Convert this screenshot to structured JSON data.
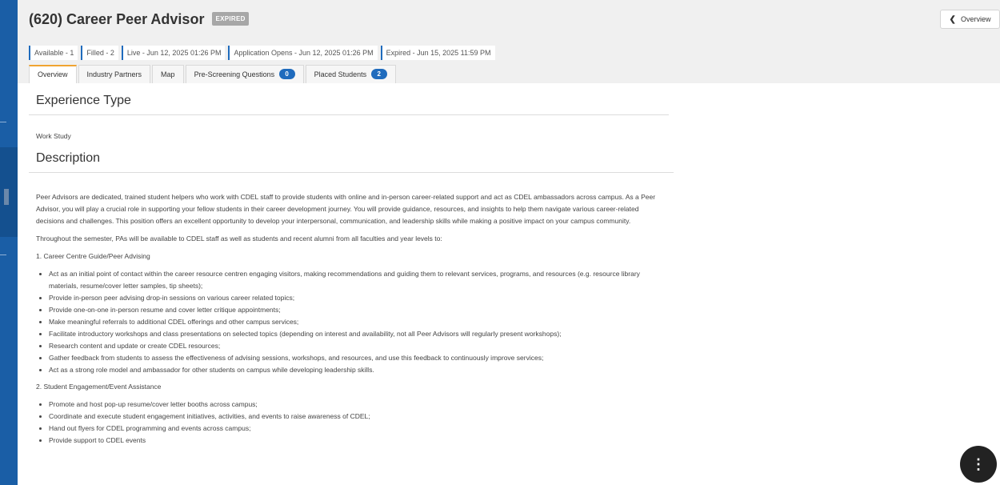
{
  "header": {
    "title": "(620) Career Peer Advisor",
    "status_badge": "EXPIRED",
    "back_button": "Overview",
    "stats": [
      "Available - 1",
      "Filled - 2",
      "Live - Jun 12, 2025 01:26 PM",
      "Application Opens - Jun 12, 2025 01:26 PM",
      "Expired - Jun 15, 2025 11:59 PM"
    ],
    "tabs": [
      {
        "label": "Overview",
        "active": true
      },
      {
        "label": "Industry Partners"
      },
      {
        "label": "Map"
      },
      {
        "label": "Pre-Screening Questions",
        "badge": "0"
      },
      {
        "label": "Placed Students",
        "badge": "2"
      }
    ]
  },
  "experience": {
    "heading": "Experience Type",
    "value": "Work Study"
  },
  "description": {
    "heading": "Description",
    "intro": "Peer Advisors are dedicated, trained student helpers who work with CDEL staff to provide students with online and in-person career-related support and act as CDEL ambassadors across campus. As a Peer Advisor, you will play a crucial role in supporting your fellow students in their career development journey. You will provide guidance, resources, and insights to help them navigate various career-related decisions and challenges. This position offers an excellent opportunity to develop your interpersonal, communication, and leadership skills while making a positive impact on your campus community.",
    "semester": "Throughout the semester, PAs will be available to CDEL staff as well as students and recent alumni from all faculties and year levels to:",
    "section1_title": "1. Career Centre Guide/Peer Advising",
    "section1_items": [
      "Act as an initial point of contact within the career resource centren engaging visitors, making recommendations and guiding them to relevant services, programs, and resources (e.g. resource library materials, resume/cover letter samples, tip sheets);",
      "Provide in-person peer advising drop-in sessions on various career related topics;",
      "Provide one-on-one in-person resume and cover letter critique appointments;",
      "Make meaningful referrals to additional CDEL offerings and other campus services;",
      "Facilitate introductory workshops and class presentations on selected topics (depending on interest and availability, not all Peer Advisors will regularly present workshops);",
      "Research content and update or create CDEL resources;",
      "Gather feedback from students to assess the effectiveness of advising sessions, workshops, and resources, and use this feedback to continuously improve services;",
      "Act as a strong role model and ambassador for other students on campus while developing leadership skills."
    ],
    "section2_title": "2. Student Engagement/Event Assistance",
    "section2_items": [
      "Promote and host pop-up resume/cover letter booths across campus;",
      "Coordinate and execute student engagement initiatives, activities, and events to raise awareness of CDEL;",
      "Hand out flyers for CDEL programming and events across campus;",
      "Provide support to CDEL events"
    ]
  },
  "fab": {
    "glyph": "⋮"
  },
  "colors": {
    "accent_blue": "#1f6bbd",
    "active_tab": "#f0a431",
    "sidebar": "#1a5ea6"
  }
}
